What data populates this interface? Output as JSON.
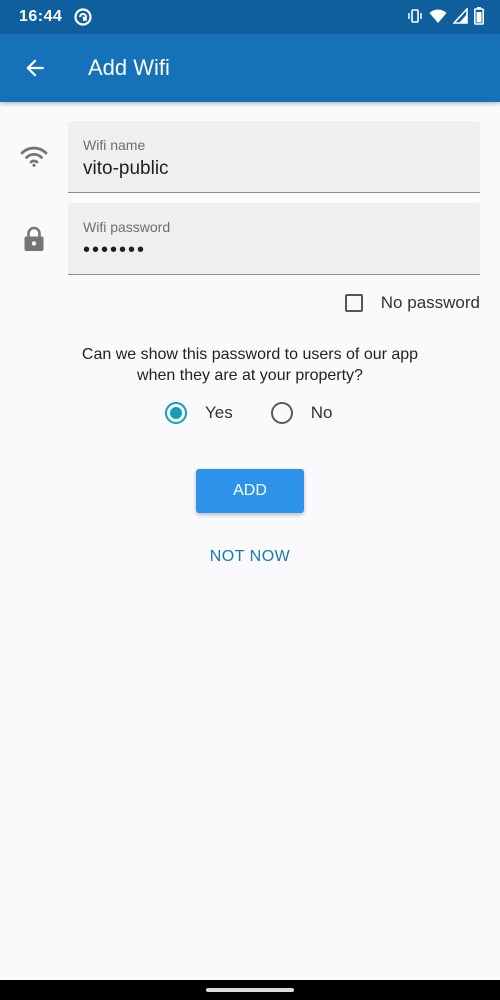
{
  "status_bar": {
    "time": "16:44",
    "icons": [
      "app-notification-icon",
      "vibrate-icon",
      "wifi-icon",
      "signal-icon",
      "battery-icon"
    ]
  },
  "app_bar": {
    "title": "Add Wifi",
    "back_icon": "arrow-back-icon",
    "color": "#1571b8"
  },
  "form": {
    "wifi_name": {
      "label": "Wifi name",
      "value": "vito-public",
      "icon": "wifi-icon"
    },
    "wifi_password": {
      "label": "Wifi password",
      "value": "•••••••",
      "icon": "lock-icon"
    },
    "no_password": {
      "label": "No password",
      "checked": false
    }
  },
  "share_question": {
    "line1": "Can we show this password to users of our app",
    "line2": "when they are at your property?",
    "options": [
      {
        "label": "Yes",
        "selected": true
      },
      {
        "label": "No",
        "selected": false
      }
    ],
    "accent_color": "#11a0b8"
  },
  "actions": {
    "add_label": "ADD",
    "not_now_label": "NOT NOW"
  }
}
